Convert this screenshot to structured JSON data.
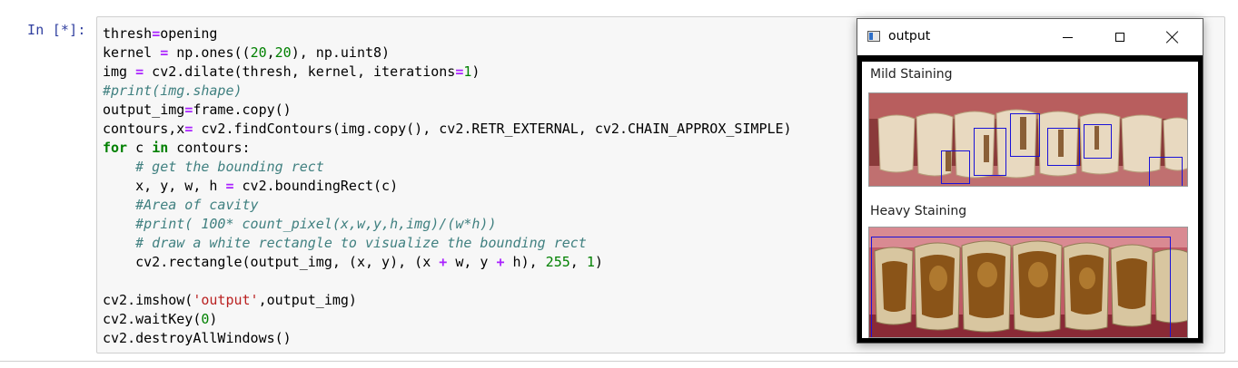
{
  "notebook": {
    "prompt": "In [*]:",
    "code_lines": [
      "thresh=opening",
      "kernel = np.ones((20,20), np.uint8)",
      "img = cv2.dilate(thresh, kernel, iterations=1)",
      "#print(img.shape)",
      "output_img=frame.copy()",
      "contours,x= cv2.findContours(img.copy(), cv2.RETR_EXTERNAL, cv2.CHAIN_APPROX_SIMPLE)",
      "for c in contours:",
      "    # get the bounding rect",
      "    x, y, w, h = cv2.boundingRect(c)",
      "    #Area of cavity",
      "    #print( 100* count_pixel(x,w,y,h,img)/(w*h))",
      "    # draw a white rectangle to visualize the bounding rect",
      "    cv2.rectangle(output_img, (x, y), (x + w, y + h), 255, 1)",
      "",
      "cv2.imshow('output',output_img)",
      "cv2.waitKey(0)",
      "cv2.destroyAllWindows()"
    ]
  },
  "window": {
    "title": "output",
    "icon": "app-window-icon",
    "controls": {
      "minimize": "minimize-icon",
      "maximize": "maximize-icon",
      "close": "close-icon"
    }
  },
  "output_image": {
    "label_1": "Mild Staining",
    "label_2": "Heavy Staining",
    "box_color": "#1a12d8"
  }
}
